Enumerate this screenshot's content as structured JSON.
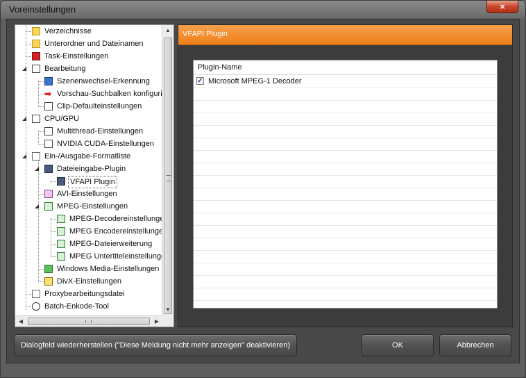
{
  "window": {
    "title": "Voreinstellungen",
    "close_glyph": "×"
  },
  "tree": {
    "items": [
      {
        "label": "Verzeichnisse",
        "icon": "folder-icon"
      },
      {
        "label": "Unterordner und Dateinamen",
        "icon": "folder-doc-icon"
      },
      {
        "label": "Task-Einstellungen",
        "icon": "task-icon"
      },
      {
        "label": "Bearbeitung",
        "icon": "edit-icon",
        "expander": "◢"
      },
      {
        "label": "Szenenwechsel-Erkennung",
        "icon": "film-icon"
      },
      {
        "label": "Vorschau-Suchbalken konfigurie",
        "icon": "red-arrow-icon",
        "glyph": "➡"
      },
      {
        "label": "Clip-Defaulteinstellungen",
        "icon": "edit-icon"
      },
      {
        "label": "CPU/GPU",
        "icon": "edit-icon",
        "expander": "◢"
      },
      {
        "label": "Multithread-Einstellungen",
        "icon": "edit-icon"
      },
      {
        "label": "NVIDIA CUDA-Einstellungen",
        "icon": "edit-icon"
      },
      {
        "label": "Ein-/Ausgabe-Formatliste",
        "icon": "doc-icon",
        "expander": "◢"
      },
      {
        "label": "Dateieingabe-Plugin",
        "icon": "monitor-icon",
        "expander": "◢"
      },
      {
        "label": "VFAPI Plugin",
        "icon": "monitor-icon"
      },
      {
        "label": "AVI-Einstellungen",
        "icon": "avi-icon"
      },
      {
        "label": "MPEG-Einstellungen",
        "icon": "mpeg-icon",
        "expander": "◢"
      },
      {
        "label": "MPEG-Decodereinstellungen",
        "icon": "mpeg-doc-icon"
      },
      {
        "label": "MPEG Encodereinstellungen",
        "icon": "mpeg-doc-icon"
      },
      {
        "label": "MPEG-Dateierweiterung",
        "icon": "mpeg-doc-icon"
      },
      {
        "label": "MPEG Untertiteleinstellungen",
        "icon": "mpeg-doc-icon"
      },
      {
        "label": "Windows Media-Einstellungen",
        "icon": "wmv-icon"
      },
      {
        "label": "DivX-Einstellungen",
        "icon": "divx-icon"
      },
      {
        "label": "Proxybearbeitungsdatei",
        "icon": "proxy-icon"
      },
      {
        "label": "Batch-Enkode-Tool",
        "icon": "clock-icon"
      }
    ],
    "selected": "VFAPI Plugin"
  },
  "scrollbars": {
    "up": "▲",
    "down": "▼",
    "left": "◀",
    "right": "▶",
    "grip_h": "|||",
    "grip_v": "≡"
  },
  "panel": {
    "header": "VFAPI Plugin",
    "column_header": "Plugin-Name",
    "rows": [
      {
        "label": "Microsoft MPEG-1 Decoder",
        "checked": true,
        "check_glyph": "✓"
      }
    ]
  },
  "buttons": {
    "restore": "Dialogfeld wiederherstellen (\"Diese Meldung nicht mehr anzeigen\" deaktivieren)",
    "ok": "OK",
    "cancel": "Abbrechen"
  }
}
